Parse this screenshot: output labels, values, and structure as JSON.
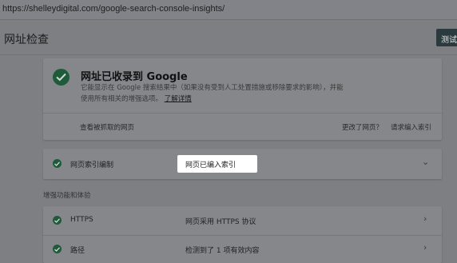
{
  "browser": {
    "url": "https://shelleydigital.com/google-search-console-insights/"
  },
  "header": {
    "title": "网址检查",
    "test_button_label": "测试实"
  },
  "status_card": {
    "title": "网址已收录到 Google",
    "description": "它能显示在 Google 搜索结果中（如果没有受到人工处置措施或移除要求的影响），并能使用所有相关的增强选项。",
    "link_text": "了解详情",
    "view_crawled_label": "查看被抓取的网页",
    "changed_page_label": "更改了网页？",
    "request_index_label": "请求编入索引"
  },
  "coverage": {
    "label": "网页索引编制",
    "value": "网页已编入索引"
  },
  "enhancements": {
    "section_title": "增强功能和体验",
    "rows": [
      {
        "label": "HTTPS",
        "value": "网页采用 HTTPS 协议"
      },
      {
        "label": "路径",
        "value": "检测到了 1 项有效内容"
      }
    ]
  },
  "icons": {
    "check": "check-circle-icon",
    "chevron_down": "chevron-down-icon",
    "chevron_right": "chevron-right-icon"
  },
  "colors": {
    "check_green": "#1f5a3b",
    "overlay_gray": "#86878b",
    "highlight_white": "#ffffff",
    "button_dark": "#2b3a3f"
  }
}
